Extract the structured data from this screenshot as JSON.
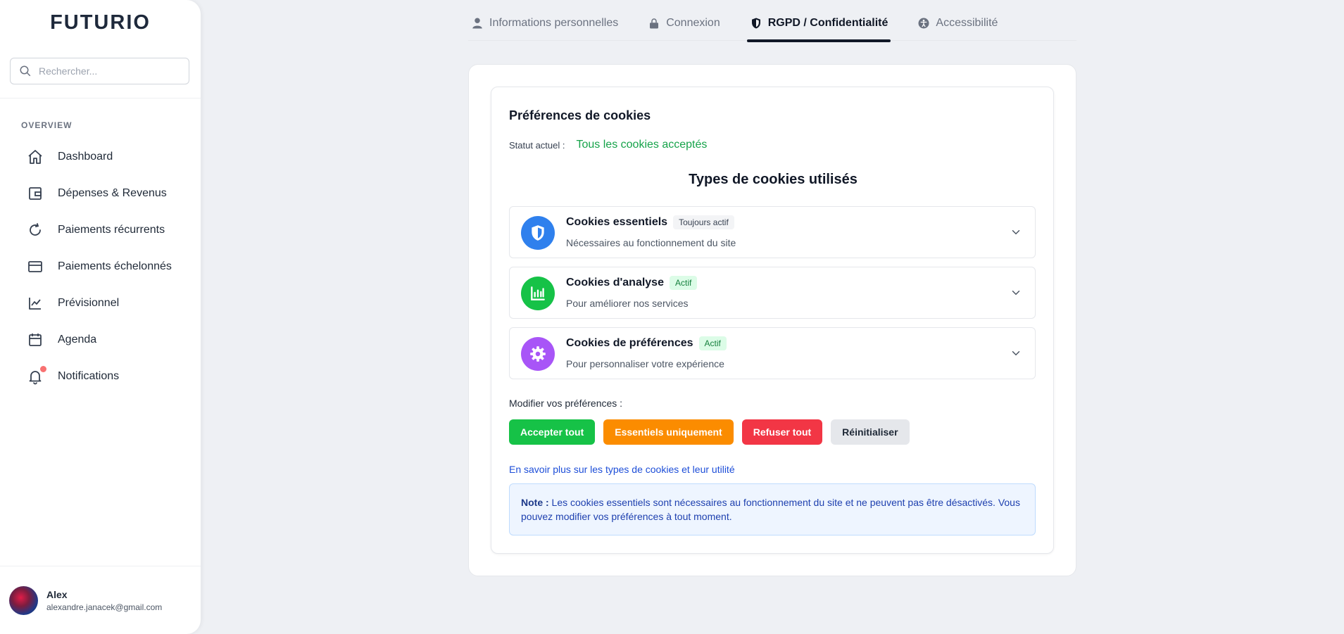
{
  "app": {
    "logo": "FUTURIO"
  },
  "search": {
    "placeholder": "Rechercher..."
  },
  "sidebar": {
    "section": "OVERVIEW",
    "items": [
      {
        "label": "Dashboard",
        "icon": "home-icon"
      },
      {
        "label": "Dépenses & Revenus",
        "icon": "wallet-icon"
      },
      {
        "label": "Paiements récurrents",
        "icon": "refresh-icon"
      },
      {
        "label": "Paiements échelonnés",
        "icon": "credit-card-icon"
      },
      {
        "label": "Prévisionnel",
        "icon": "chart-line-icon"
      },
      {
        "label": "Agenda",
        "icon": "calendar-icon"
      },
      {
        "label": "Notifications",
        "icon": "bell-icon"
      }
    ]
  },
  "user": {
    "name": "Alex",
    "email": "alexandre.janacek@gmail.com"
  },
  "tabs": [
    {
      "label": "Informations personnelles",
      "icon": "user-icon"
    },
    {
      "label": "Connexion",
      "icon": "lock-icon"
    },
    {
      "label": "RGPD / Confidentialité",
      "icon": "shield-icon",
      "active": true
    },
    {
      "label": "Accessibilité",
      "icon": "accessibility-icon"
    }
  ],
  "cookies": {
    "title": "Préférences de cookies",
    "status_label": "Statut actuel :",
    "status_value": "Tous les cookies acceptés",
    "types_title": "Types de cookies utilisés",
    "items": [
      {
        "title": "Cookies essentiels",
        "badge": "Toujours actif",
        "desc": "Nécessaires au fonctionnement du site",
        "icon": "shield-icon",
        "color": "#2f80ed"
      },
      {
        "title": "Cookies d'analyse",
        "badge": "Actif",
        "desc": "Pour améliorer nos services",
        "icon": "chart-bar-icon",
        "color": "#16c247"
      },
      {
        "title": "Cookies de préférences",
        "badge": "Actif",
        "desc": "Pour personnaliser votre expérience",
        "icon": "gear-icon",
        "color": "#a855f7"
      }
    ],
    "modify_label": "Modifier vos préférences :",
    "buttons": {
      "accept": "Accepter tout",
      "essential": "Essentiels uniquement",
      "refuse": "Refuser tout",
      "reset": "Réinitialiser"
    },
    "learn_more": "En savoir plus sur les types de cookies et leur utilité",
    "note_label": "Note :",
    "note_text": " Les cookies essentiels sont nécessaires au fonctionnement du site et ne peuvent pas être désactivés. Vous pouvez modifier vos préférences à tout moment."
  }
}
